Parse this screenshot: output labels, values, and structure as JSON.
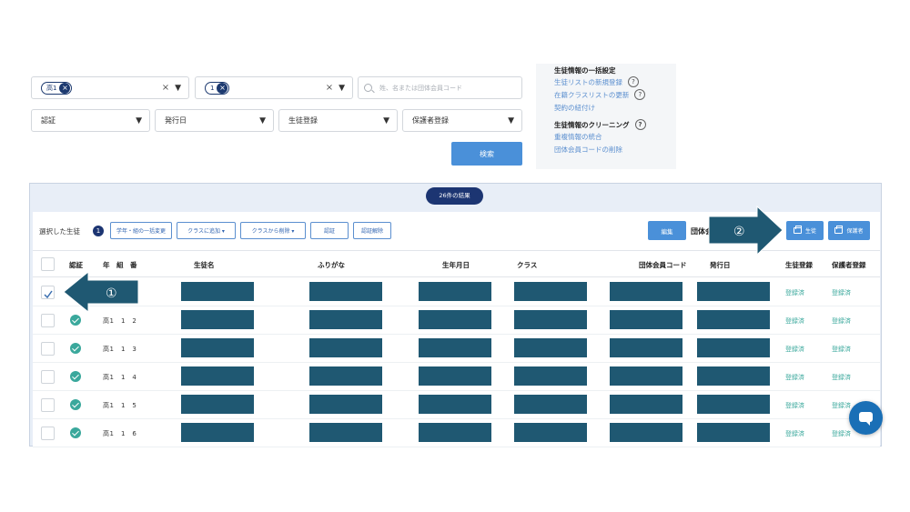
{
  "filters": {
    "grade": {
      "chip": "高1"
    },
    "class": {
      "chip": "1"
    },
    "search_placeholder": "姓、名または団体会員コード",
    "auth": "認証",
    "issue_date": "発行日",
    "student_reg": "生徒登録",
    "guardian_reg": "保護者登録",
    "search_button": "検索",
    "clear_glyph": "×",
    "caret_glyph": "▼"
  },
  "menu": {
    "bulk_heading": "生徒情報の一括設定",
    "bulk_links": [
      "生徒リストの新規登録",
      "在籍クラスリストの更新",
      "契約の紐付け"
    ],
    "clean_heading": "生徒情報のクリーニング",
    "clean_links": [
      "重複情報の統合",
      "団体会員コードの削除"
    ],
    "help_glyph": "?"
  },
  "results": {
    "count_label": "26件の結果",
    "selected_label": "選択した生徒",
    "selected_count": "1",
    "actions": [
      "学年・組の一括変更",
      "クラスに追加 ▾",
      "クラスから削除 ▾",
      "認証",
      "認証解除"
    ],
    "edit_button": "編集",
    "group_label": "団体会",
    "print_student": "生徒",
    "print_guardian": "保護者"
  },
  "table": {
    "headers": {
      "auth": "認証",
      "grade": "年　組　番",
      "name": "生徒名",
      "kana": "ふりがな",
      "birth": "生年月日",
      "class": "クラス",
      "code": "団体会員コード",
      "issue": "発行日",
      "student_reg": "生徒登録",
      "guardian_reg": "保護者登録"
    },
    "rows": [
      {
        "selected": true,
        "verified": false,
        "grade": "",
        "student_reg": "登録済",
        "guardian_reg": "登録済"
      },
      {
        "selected": false,
        "verified": true,
        "grade": "高1　1　2",
        "student_reg": "登録済",
        "guardian_reg": "登録済"
      },
      {
        "selected": false,
        "verified": true,
        "grade": "高1　1　3",
        "student_reg": "登録済",
        "guardian_reg": "登録済"
      },
      {
        "selected": false,
        "verified": true,
        "grade": "高1　1　4",
        "student_reg": "登録済",
        "guardian_reg": "登録済"
      },
      {
        "selected": false,
        "verified": true,
        "grade": "高1　1　5",
        "student_reg": "登録済",
        "guardian_reg": "登録済"
      },
      {
        "selected": false,
        "verified": true,
        "grade": "高1　1　6",
        "student_reg": "登録済",
        "guardian_reg": "登録済"
      }
    ]
  },
  "annotations": {
    "step1": "①",
    "step2": "②"
  },
  "colors": {
    "accent": "#4a90d9",
    "navy": "#1c3572",
    "redaction": "#1f5872",
    "arrow": "#1f5872",
    "teal": "#3aa89c"
  }
}
